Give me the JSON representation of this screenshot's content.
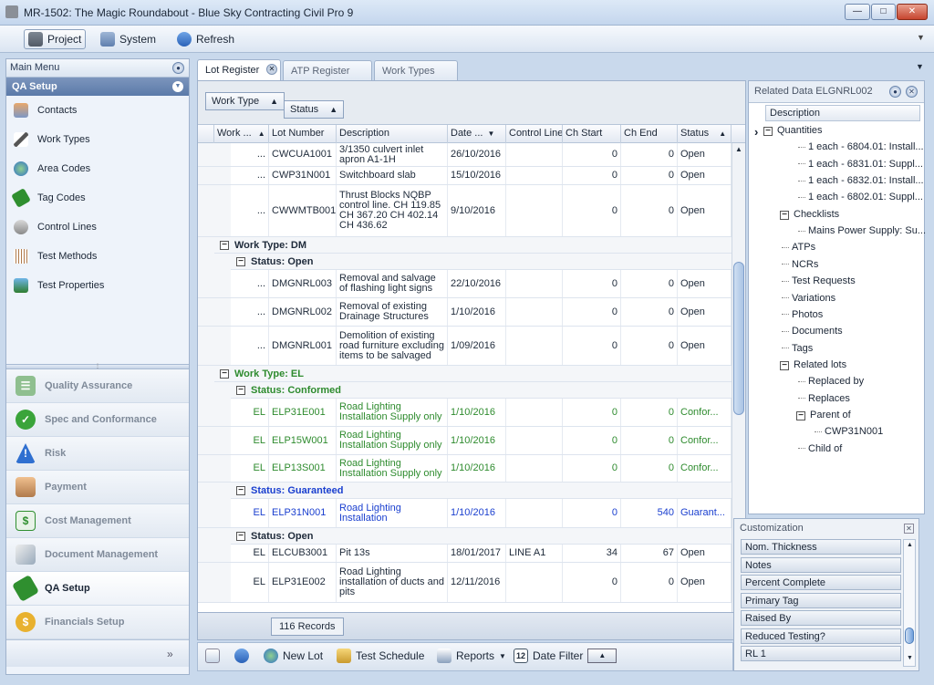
{
  "window": {
    "title": "MR-1502: The Magic Roundabout - Blue Sky Contracting Civil Pro 9"
  },
  "toolbar": {
    "project": "Project",
    "system": "System",
    "refresh": "Refresh"
  },
  "left": {
    "main_menu": "Main Menu",
    "section": "QA Setup",
    "items": [
      "Contacts",
      "Work Types",
      "Area Codes",
      "Tag Codes",
      "Control Lines",
      "Test Methods",
      "Test Properties"
    ],
    "nav": [
      "Quality Assurance",
      "Spec and Conformance",
      "Risk",
      "Payment",
      "Cost Management",
      "Document Management",
      "QA Setup",
      "Financials Setup"
    ],
    "more": "»"
  },
  "tabs": [
    "Lot Register",
    "ATP Register",
    "Work Types"
  ],
  "group": {
    "work_type": "Work Type",
    "status": "Status"
  },
  "columns": [
    "Work ...",
    "Lot Number",
    "Description",
    "Date ...",
    "Control Line",
    "Ch Start",
    "Ch End",
    "Status"
  ],
  "groups": {
    "dm": "Work Type: DM",
    "el": "Work Type: EL",
    "open": "Status: Open",
    "conformed": "Status: Conformed",
    "guaranteed": "Status: Guaranteed",
    "open2": "Status: Open"
  },
  "rows": [
    {
      "wt": "...",
      "lot": "CWCUA1001",
      "desc": "3/1350 culvert inlet apron A1-1H",
      "date": "26/10/2016",
      "cl": "",
      "cs": "0",
      "ce": "0",
      "st": "Open"
    },
    {
      "wt": "...",
      "lot": "CWP31N001",
      "desc": "Switchboard slab",
      "date": "15/10/2016",
      "cl": "",
      "cs": "0",
      "ce": "0",
      "st": "Open"
    },
    {
      "wt": "...",
      "lot": "CWWMTB001",
      "desc": "Thrust Blocks NQBP control line. CH 119.85 CH 367.20 CH 402.14 CH 436.62",
      "date": "9/10/2016",
      "cl": "",
      "cs": "0",
      "ce": "0",
      "st": "Open"
    },
    {
      "wt": "...",
      "lot": "DMGNRL003",
      "desc": "Removal and salvage of flashing light signs",
      "date": "22/10/2016",
      "cl": "",
      "cs": "0",
      "ce": "0",
      "st": "Open"
    },
    {
      "wt": "...",
      "lot": "DMGNRL002",
      "desc": "Removal of existing Drainage Structures",
      "date": "1/10/2016",
      "cl": "",
      "cs": "0",
      "ce": "0",
      "st": "Open"
    },
    {
      "wt": "...",
      "lot": "DMGNRL001",
      "desc": "Demolition of existing road furniture excluding items to be salvaged",
      "date": "1/09/2016",
      "cl": "",
      "cs": "0",
      "ce": "0",
      "st": "Open"
    },
    {
      "wt": "EL",
      "lot": "ELP31E001",
      "desc": "Road Lighting Installation Supply only",
      "date": "1/10/2016",
      "cl": "",
      "cs": "0",
      "ce": "0",
      "st": "Confor..."
    },
    {
      "wt": "EL",
      "lot": "ELP15W001",
      "desc": "Road Lighting Installation Supply only",
      "date": "1/10/2016",
      "cl": "",
      "cs": "0",
      "ce": "0",
      "st": "Confor..."
    },
    {
      "wt": "EL",
      "lot": "ELP13S001",
      "desc": "Road Lighting Installation Supply only",
      "date": "1/10/2016",
      "cl": "",
      "cs": "0",
      "ce": "0",
      "st": "Confor..."
    },
    {
      "wt": "EL",
      "lot": "ELP31N001",
      "desc": "Road Lighting Installation",
      "date": "1/10/2016",
      "cl": "",
      "cs": "0",
      "ce": "540",
      "st": "Guarant..."
    },
    {
      "wt": "EL",
      "lot": "ELCUB3001",
      "desc": "Pit 13s",
      "date": "18/01/2017",
      "cl": "LINE A1",
      "cs": "34",
      "ce": "67",
      "st": "Open"
    },
    {
      "wt": "EL",
      "lot": "ELP31E002",
      "desc": " Road Lighting installation of ducts and pits",
      "date": "12/11/2016",
      "cl": "",
      "cs": "0",
      "ce": "0",
      "st": "Open"
    }
  ],
  "records": "116 Records",
  "bottom": {
    "new_lot": "New Lot",
    "test_schedule": "Test Schedule",
    "reports": "Reports",
    "date_filter": "Date Filter",
    "cal_day": "12"
  },
  "related": {
    "title": "Related Data ELGNRL002",
    "col": "Description",
    "nodes": [
      "Quantities",
      "1 each - 6804.01: Install...",
      "1 each - 6831.01: Suppl...",
      "1 each - 6832.01: Install...",
      "1 each - 6802.01: Suppl...",
      "Checklists",
      "Mains Power Supply: Su...",
      "ATPs",
      "NCRs",
      "Test Requests",
      "Variations",
      "Photos",
      "Documents",
      "Tags",
      "Related lots",
      "Replaced by",
      "Replaces",
      "Parent of",
      "CWP31N001",
      "Child of"
    ]
  },
  "custom": {
    "title": "Customization",
    "items": [
      "Nom. Thickness",
      "Notes",
      "Percent Complete",
      "Primary Tag",
      "Raised By",
      "Reduced Testing?",
      "RL 1"
    ]
  },
  "colors": {
    "accent": "#5b7aa9",
    "conformed": "#2e8b2e",
    "guaranteed": "#1a3fcf"
  }
}
